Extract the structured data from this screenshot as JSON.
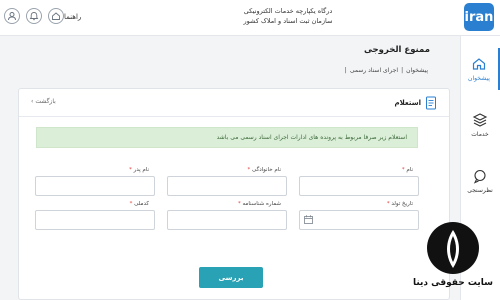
{
  "header": {
    "logo_text": "iran",
    "portal_line1": "درگاه یکپارچه خدمات الکترونیکی",
    "portal_line2": "سازمان ثبت اسناد و املاک کشور",
    "help_label": "راهنما",
    "icons": [
      "user-icon",
      "bell-icon",
      "home-icon"
    ]
  },
  "sidebar": {
    "items": [
      {
        "label": "پیشخوان",
        "icon": "home-icon",
        "active": true
      },
      {
        "label": "خدمات",
        "icon": "layers-icon"
      },
      {
        "label": "نظرسنجی",
        "icon": "chat-icon"
      }
    ]
  },
  "page": {
    "title": "ممنوع الخروجی",
    "breadcrumb": [
      "پیشخوان",
      "|",
      "اجرای اسناد رسمی",
      "|"
    ]
  },
  "card": {
    "title": "استعلام",
    "back": "بازگشت"
  },
  "info": "استعلام زیر صرفا مربوط به پرونده های ادارات اجرای اسناد رسمی می باشد",
  "form": {
    "first_name": "نام",
    "last_name": "نام خانوادگی",
    "father_name": "نام پدر",
    "birth_date": "تاریخ تولد",
    "id_number": "شماره شناسنامه",
    "national_code": "کدملی",
    "required_mark": "*"
  },
  "search_button": "بررسی",
  "watermark": "سایت حقوقی دینا",
  "colors": {
    "accent": "#2a7fd0",
    "button": "#28a2b4",
    "info_bg": "#dbeed8"
  }
}
